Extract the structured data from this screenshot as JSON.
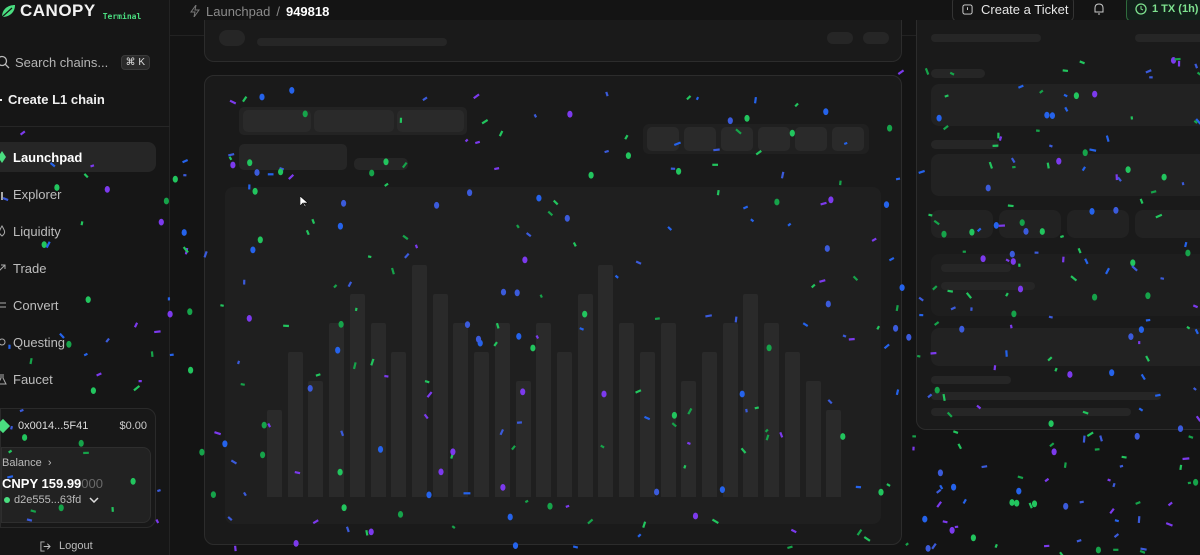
{
  "app": {
    "brand": "CANOPY",
    "brand_sub": "Terminal"
  },
  "sidebar": {
    "search_label": "Search chains...",
    "search_shortcut": "⌘ K",
    "create_label": "Create L1 chain",
    "items": [
      {
        "label": "Launchpad",
        "icon": "rocket-icon",
        "active": true
      },
      {
        "label": "Explorer",
        "icon": "chart-icon"
      },
      {
        "label": "Liquidity",
        "icon": "droplet-icon"
      },
      {
        "label": "Trade",
        "icon": "trend-arrow-icon"
      },
      {
        "label": "Convert",
        "icon": "swap-icon"
      },
      {
        "label": "Questing",
        "icon": "target-icon"
      },
      {
        "label": "Faucet",
        "icon": "flask-icon"
      }
    ],
    "wallet": {
      "address": "0x0014...5F41",
      "amount": "$0.00",
      "balance_label": "Balance",
      "balance_symbol": "CNPY",
      "balance_int": "159.99",
      "balance_dim": "000",
      "account": "d2e555...63fd"
    },
    "logout_label": "Logout"
  },
  "header": {
    "crumb_root": "Launchpad",
    "crumb_sep": "/",
    "crumb_current": "949818",
    "ticket_label": "Create a Ticket",
    "tx_label": "1 TX (1h)"
  },
  "colors": {
    "accent": "#4ade80",
    "bg": "#141414",
    "panel": "#1a1a1a"
  },
  "chart_data": {
    "type": "bar",
    "title": "",
    "xlabel": "",
    "ylabel": "",
    "values": [
      3,
      5,
      4,
      6,
      7,
      6,
      5,
      8,
      7,
      6,
      5,
      6,
      4,
      6,
      5,
      7,
      8,
      6,
      5,
      6,
      4,
      5,
      6,
      7,
      6,
      5,
      4,
      3
    ],
    "ylim": [
      0,
      10
    ],
    "loading": true
  }
}
